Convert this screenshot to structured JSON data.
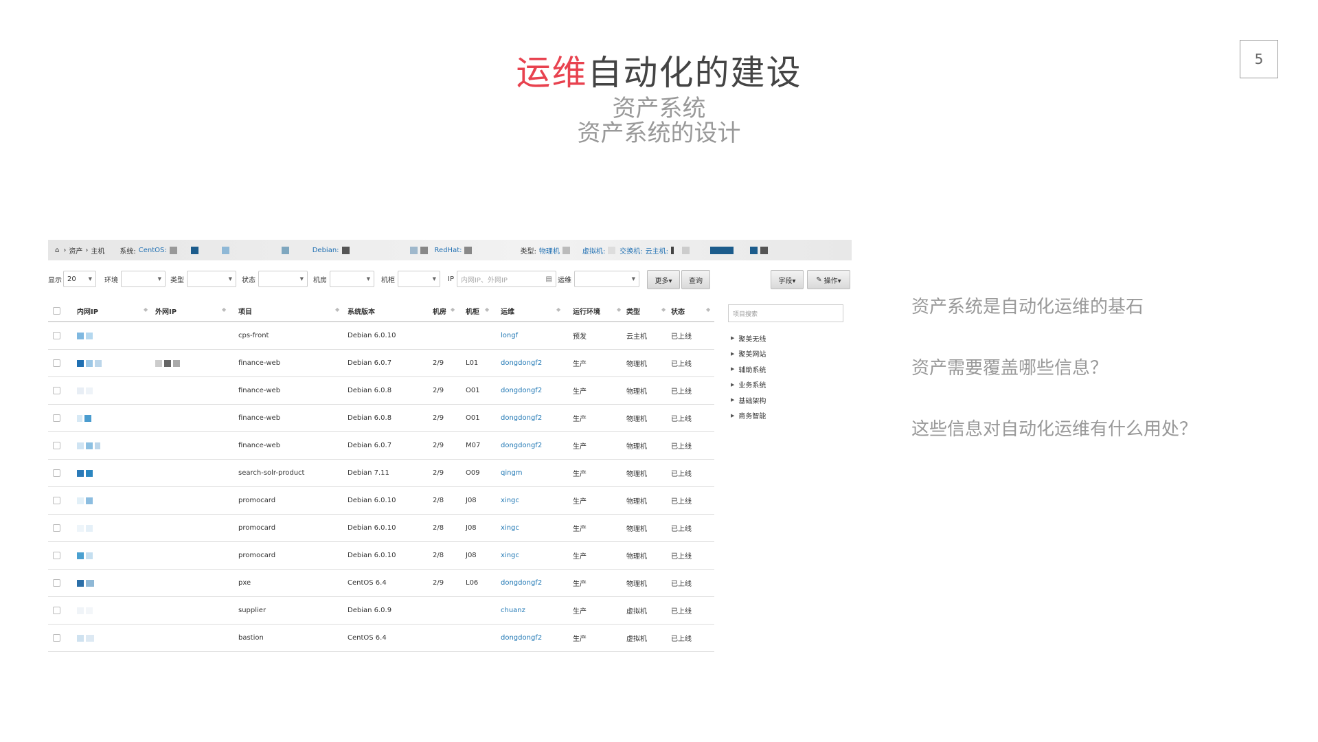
{
  "slide": {
    "title_accent": "运维",
    "title_rest": "自动化的建设",
    "subtitle_line1": "资产系统",
    "subtitle_line2": "资产系统的设计",
    "page_number": "5",
    "bullets": [
      "资产系统是自动化运维的基石",
      "资产需要覆盖哪些信息？",
      "这些信息对自动化运维有什么用处？"
    ]
  },
  "colors": {
    "accent": "#e8424f",
    "link": "#1f77b4",
    "text_gray": "#999999"
  },
  "breadcrumb": {
    "home_icon": "home-icon",
    "items": [
      "资产",
      "主机"
    ],
    "separator": "›",
    "system_label": "系统:",
    "centos": "CentOS:",
    "debian": "Debian:",
    "redhat": "RedHat:",
    "type_label": "类型:",
    "physical": "物理机",
    "virtual": "虚拟机:",
    "switch": "交换机:",
    "cloud": "云主机:"
  },
  "filters": {
    "show_label": "显示",
    "show_value": "20",
    "env_label": "环境",
    "type_label": "类型",
    "status_label": "状态",
    "room_label": "机房",
    "rack_label": "机柜",
    "ip_label": "IP",
    "ip_placeholder": "内网IP、外网IP",
    "ops_label": "运维",
    "more_button": "更多▾",
    "query_button": "查询",
    "fields_button": "字段▾",
    "action_button": "操作▾"
  },
  "table": {
    "headers": {
      "inner_ip": "内网IP",
      "outer_ip": "外网IP",
      "project": "项目",
      "os": "系统版本",
      "room": "机房",
      "rack": "机柜",
      "ops": "运维",
      "env": "运行环境",
      "type": "类型",
      "status": "状态"
    },
    "rows": [
      {
        "project": "cps-front",
        "os": "Debian 6.0.10",
        "room": "",
        "rack": "",
        "ops": "longf",
        "env": "预发",
        "type": "云主机",
        "status": "已上线"
      },
      {
        "project": "finance-web",
        "os": "Debian 6.0.7",
        "room": "2/9",
        "rack": "L01",
        "ops": "dongdongf2",
        "env": "生产",
        "type": "物理机",
        "status": "已上线"
      },
      {
        "project": "finance-web",
        "os": "Debian 6.0.8",
        "room": "2/9",
        "rack": "O01",
        "ops": "dongdongf2",
        "env": "生产",
        "type": "物理机",
        "status": "已上线"
      },
      {
        "project": "finance-web",
        "os": "Debian 6.0.8",
        "room": "2/9",
        "rack": "O01",
        "ops": "dongdongf2",
        "env": "生产",
        "type": "物理机",
        "status": "已上线"
      },
      {
        "project": "finance-web",
        "os": "Debian 6.0.7",
        "room": "2/9",
        "rack": "M07",
        "ops": "dongdongf2",
        "env": "生产",
        "type": "物理机",
        "status": "已上线"
      },
      {
        "project": "search-solr-product",
        "os": "Debian 7.11",
        "room": "2/9",
        "rack": "O09",
        "ops": "qingm",
        "env": "生产",
        "type": "物理机",
        "status": "已上线"
      },
      {
        "project": "promocard",
        "os": "Debian 6.0.10",
        "room": "2/8",
        "rack": "J08",
        "ops": "xingc",
        "env": "生产",
        "type": "物理机",
        "status": "已上线"
      },
      {
        "project": "promocard",
        "os": "Debian 6.0.10",
        "room": "2/8",
        "rack": "J08",
        "ops": "xingc",
        "env": "生产",
        "type": "物理机",
        "status": "已上线"
      },
      {
        "project": "promocard",
        "os": "Debian 6.0.10",
        "room": "2/8",
        "rack": "J08",
        "ops": "xingc",
        "env": "生产",
        "type": "物理机",
        "status": "已上线"
      },
      {
        "project": "pxe",
        "os": "CentOS 6.4",
        "room": "2/9",
        "rack": "L06",
        "ops": "dongdongf2",
        "env": "生产",
        "type": "物理机",
        "status": "已上线"
      },
      {
        "project": "supplier",
        "os": "Debian 6.0.9",
        "room": "",
        "rack": "",
        "ops": "chuanz",
        "env": "生产",
        "type": "虚拟机",
        "status": "已上线"
      },
      {
        "project": "bastion",
        "os": "CentOS 6.4",
        "room": "",
        "rack": "",
        "ops": "dongdongf2",
        "env": "生产",
        "type": "虚拟机",
        "status": "已上线"
      }
    ]
  },
  "tree": {
    "search_placeholder": "项目搜索",
    "items": [
      "聚美无线",
      "聚美网站",
      "辅助系统",
      "业务系统",
      "基础架构",
      "商务智能"
    ]
  }
}
